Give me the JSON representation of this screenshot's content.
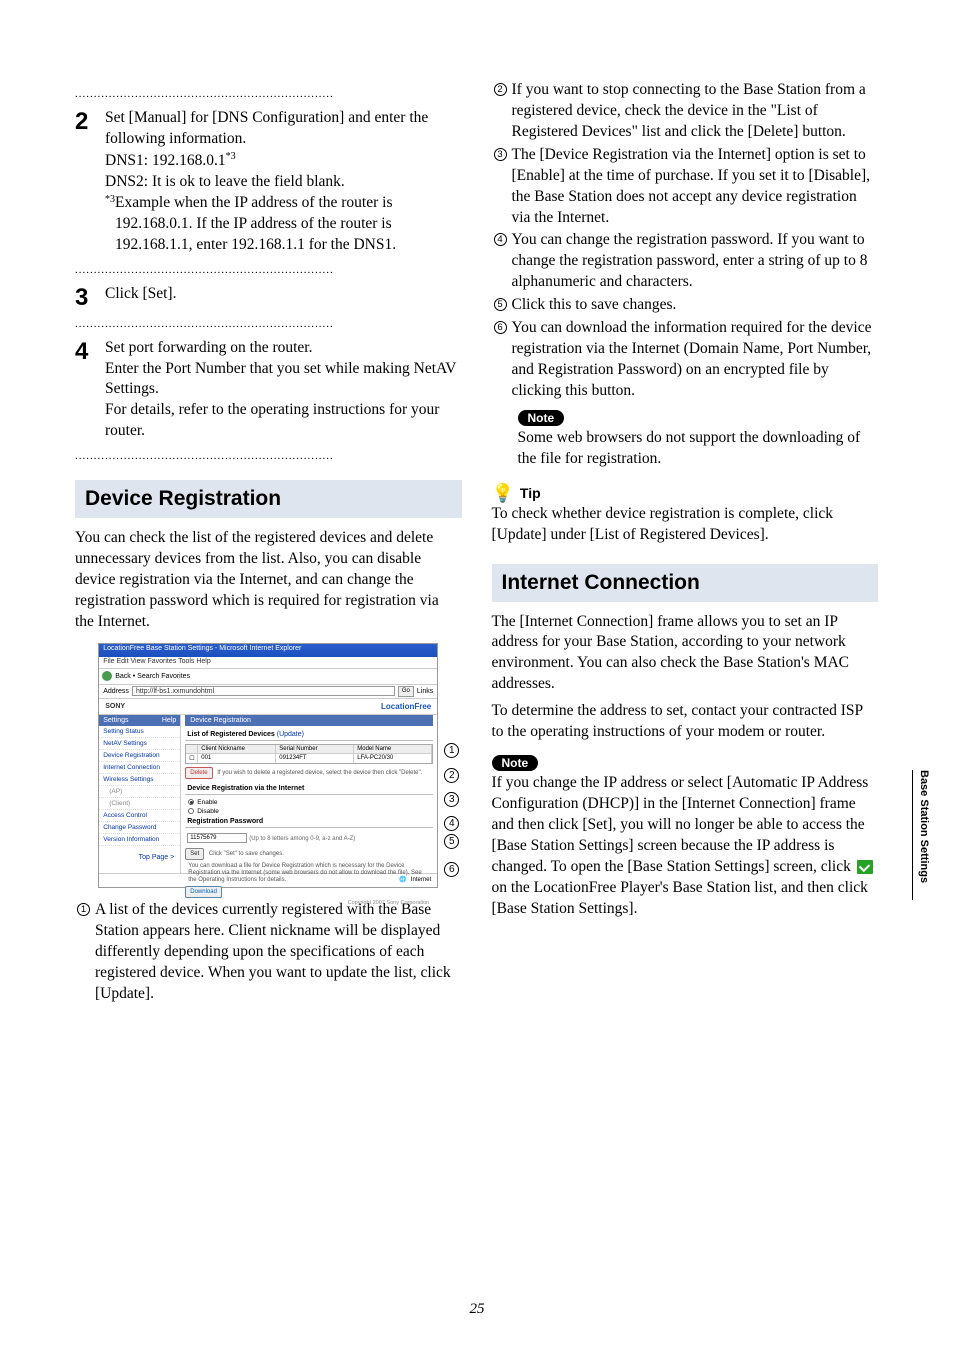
{
  "left": {
    "step2": {
      "num": "2",
      "l1": "Set [Manual] for [DNS Configuration] and enter the following information.",
      "dns1_label": "DNS1: 192.168.0.1",
      "dns1_sup": "*3",
      "dns2": "DNS2: It is ok to leave the field blank.",
      "fn_marker": "*3",
      "fn_text": " Example when the IP address of the router is 192.168.0.1. If the IP address of the router is 192.168.1.1, enter 192.168.1.1 for the DNS1."
    },
    "step3": {
      "num": "3",
      "text": "Click [Set]."
    },
    "step4": {
      "num": "4",
      "l1": "Set port forwarding on the router.",
      "l2": "Enter the Port Number that you set while making NetAV Settings.",
      "l3": "For details, refer to the operating instructions for your router."
    },
    "heading1": "Device Registration",
    "intro1": "You can check the list of the registered devices and delete unnecessary devices from the list. Also, you can disable device registration via the Internet, and can change the registration password which is required for registration via the Internet.",
    "screenshot": {
      "title": "LocationFree Base Station Settings - Microsoft Internet Explorer",
      "menu": "File   Edit   View   Favorites   Tools   Help",
      "toolbar": "Back  •        Search    Favorites",
      "addr_label": "Address",
      "addr_url": "http://lf-bs1.xxmundohtml",
      "go": "Go",
      "links": "Links",
      "brand_left": "SONY",
      "brand_right": "LocationFree",
      "sidebar": {
        "head_l": "Settings",
        "head_r": "Help",
        "items": [
          "Setting Status",
          "NetAV Settings",
          "Device Registration",
          "Internet Connection",
          "Wireless Settings",
          "(AP)",
          "(Client)",
          "Access Control",
          "Change Password",
          "Version Information"
        ],
        "top": "Top Page >"
      },
      "content": {
        "head": "Device Registration",
        "list_label": "List of Registered Devices ",
        "list_update": "(Update)",
        "th1": "Client Nickname",
        "th2": "Serial Number",
        "th3": "Model Name",
        "td1": "001",
        "td2": "091234FT",
        "td3": "LFA-PC20/30",
        "del_btn": "Delete",
        "del_text": " If you wish to delete a registered device, select the device then click \"Delete\".",
        "via_head": "Device Registration via the Internet",
        "r_enable": "Enable",
        "r_disable": "Disable",
        "pw_head": "Registration Password",
        "pw_val": "11575679",
        "pw_hint": "(Up to 8 letters among 0-9, a-z and A-Z)",
        "set_btn": "Set",
        "set_text": " Click \"Set\" to save changes.",
        "dl_text": "You can download a file for Device Registration which is necessary for the Device Registration via the Internet (some web browsers do not allow to download the file). See the Operating Instructions for details.",
        "dl_btn": "Download",
        "copy": "Copyright 2007 Sony Corporation",
        "status_internet": "Internet"
      }
    },
    "enum1": "A list of the devices currently registered with the Base Station appears here. Client nickname will be displayed differently depending upon the specifications of each registered device. When you want to update the list, click [Update]."
  },
  "right": {
    "enum2": "If you want to stop connecting to the Base Station from a registered device, check the device in the \"List of Registered Devices\" list and click the [Delete] button.",
    "enum3": "The [Device Registration via the Internet] option is set to [Enable] at the time of purchase. If you set it to [Disable], the Base Station does not accept any device registration via the Internet.",
    "enum4": "You can change the registration password. If you want to change the registration password, enter a string of up to 8 alphanumeric and characters.",
    "enum5": "Click this to save changes.",
    "enum6": "You can download the information required for the device registration via the Internet (Domain Name, Port Number, and Registration Password) on an encrypted file by clicking this button.",
    "note1_label": "Note",
    "note1_text": "Some web browsers do not support the downloading of the file for registration.",
    "tip_label": "Tip",
    "tip_text": "To check whether device registration is complete, click [Update] under [List of Registered Devices].",
    "heading2": "Internet Connection",
    "para2a": "The [Internet Connection] frame allows you to set an IP address for your Base Station, according to your network environment. You can also check the Base Station's MAC addresses.",
    "para2b": "To determine the address to set, contact your contracted ISP to the operating instructions of your modem or router.",
    "note2_label": "Note",
    "note2_text_a": "If you change the IP address or select [Automatic IP Address Configuration (DHCP)] in the [Internet Connection] frame and then click [Set], you will no longer be able to access the [Base Station Settings] screen because the IP address is changed. To open the [Base Station Settings] screen, click ",
    "note2_text_b": " on the LocationFree Player's Base Station list, and then click [Base Station Settings]."
  },
  "side_tab": "Base Station Settings",
  "page_num": "25",
  "callouts": [
    "1",
    "2",
    "3",
    "4",
    "5",
    "6"
  ]
}
